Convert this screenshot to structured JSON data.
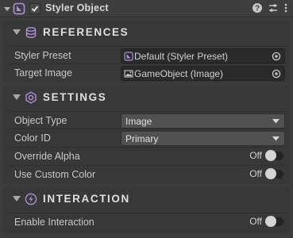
{
  "component": {
    "title": "Styler Object",
    "enabled": true
  },
  "colors": {
    "accent_purple": "#b08fd8",
    "background": "#383838",
    "field": "#2a2a2a",
    "dropdown": "#515151"
  },
  "sections": {
    "references": {
      "title": "REFERENCES",
      "icon": "database-icon",
      "styler_preset": {
        "label": "Styler Preset",
        "value": "Default (Styler Preset)"
      },
      "target_image": {
        "label": "Target Image",
        "value": "GameObject (Image)"
      }
    },
    "settings": {
      "title": "SETTINGS",
      "icon": "hexagon-gear-icon",
      "object_type": {
        "label": "Object Type",
        "value": "Image"
      },
      "color_id": {
        "label": "Color ID",
        "value": "Primary"
      },
      "override_alpha": {
        "label": "Override Alpha",
        "state": "Off"
      },
      "use_custom_color": {
        "label": "Use Custom Color",
        "state": "Off"
      }
    },
    "interaction": {
      "title": "INTERACTION",
      "icon": "lightning-icon",
      "enable_interaction": {
        "label": "Enable Interaction",
        "state": "Off"
      }
    }
  }
}
